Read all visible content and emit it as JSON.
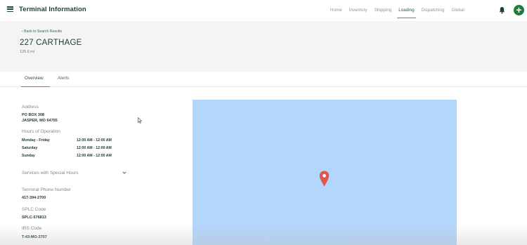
{
  "app": {
    "title": "Terminal Information"
  },
  "nav": {
    "items": [
      {
        "label": "Home"
      },
      {
        "label": "Inventory"
      },
      {
        "label": "Shipping"
      },
      {
        "label": "Loading",
        "active": true
      },
      {
        "label": "Dispatching"
      },
      {
        "label": "Global"
      }
    ],
    "bell_icon": "bell-icon",
    "add_icon": "plus-icon",
    "accent_color": "#1f7a3c"
  },
  "header": {
    "back_label": "Back to Search Results",
    "title": "227 CARTHAGE",
    "distance": "125.6 mi"
  },
  "tabs": [
    {
      "label": "Overview",
      "active": true
    },
    {
      "label": "Alerts"
    }
  ],
  "details": {
    "address_label": "Address",
    "address_line1": "PO BOX 308",
    "address_line2": "JASPER, MO 64755",
    "hours_label": "Hours of Operation",
    "hours": [
      {
        "day": "Monday - Friday",
        "time": "12:00 AM - 12:00 AM"
      },
      {
        "day": "Saturday",
        "time": "12:00 AM - 12:00 AM"
      },
      {
        "day": "Sunday",
        "time": "12:00 AM - 12:00 AM"
      }
    ],
    "special_hours_label": "Services with Special Hours",
    "phone_label": "Terminal Phone Number",
    "phone": "417-394-2700",
    "splc_label": "SPLC Code",
    "splc": "SPLC-576813",
    "irs_label": "IRS Code",
    "irs": "T-43-MO-3707"
  },
  "map": {
    "water_color": "#b3d6fb",
    "pin_color": "#e0574a",
    "pin_icon": "map-pin-icon"
  }
}
